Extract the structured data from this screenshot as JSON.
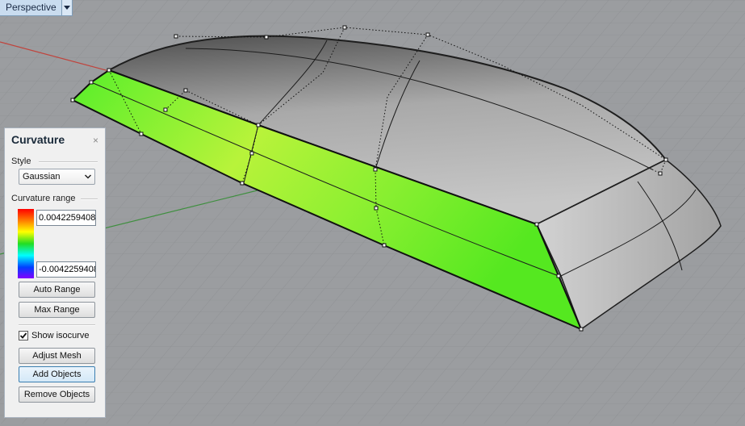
{
  "viewport": {
    "name": "Perspective"
  },
  "panel": {
    "title": "Curvature",
    "close_glyph": "×",
    "style_label": "Style",
    "style_value": "Gaussian",
    "range_label": "Curvature range",
    "range_max": "0.0042259408",
    "range_min": "-0.0042259408",
    "buttons": {
      "auto_range": "Auto Range",
      "max_range": "Max Range",
      "adjust_mesh": "Adjust Mesh",
      "add_objects": "Add Objects",
      "remove_objects": "Remove Objects"
    },
    "show_isocurve_label": "Show isocurve",
    "show_isocurve_checked": true
  },
  "colors": {
    "viewport_bg": "#9a9c9f",
    "grid": "#8d8f92",
    "x_axis": "#c0443d",
    "y_axis": "#3f8f3f",
    "analysis_green": "#66ee22"
  },
  "icons": {
    "dropdown": "chevron-down-icon",
    "checkbox": "checkmark-icon"
  }
}
